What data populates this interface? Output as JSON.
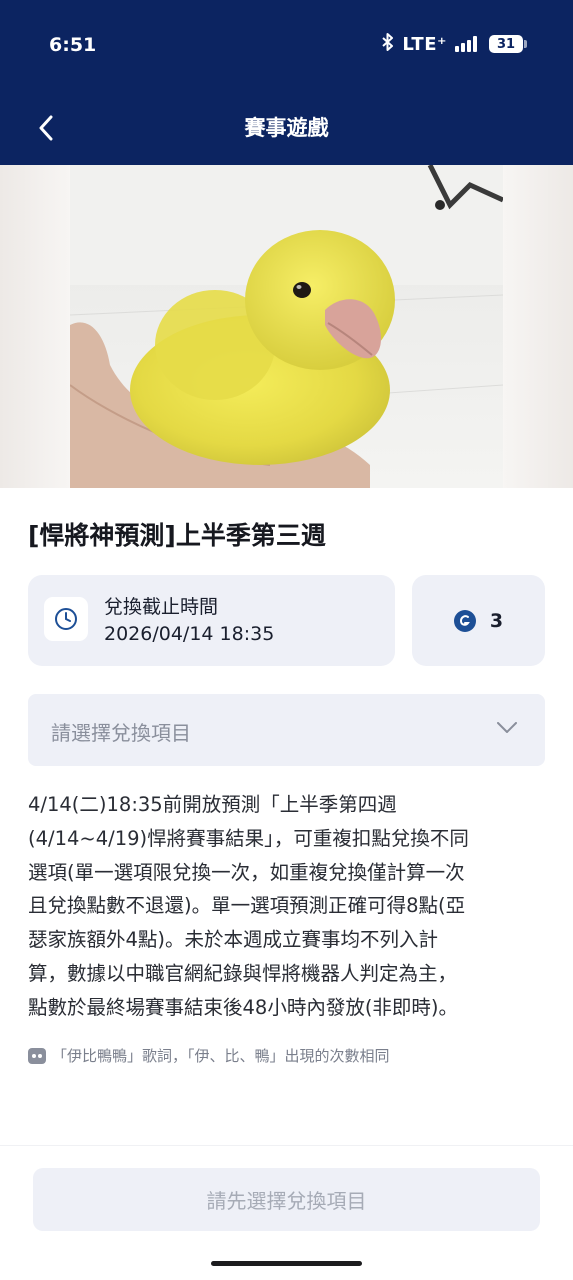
{
  "status_bar": {
    "time": "6:51",
    "network": "LTE⁺",
    "battery": "31"
  },
  "header": {
    "title": "賽事遊戲"
  },
  "event": {
    "title": "[悍將神預測]上半季第三週",
    "deadline_label": "兌換截止時間",
    "deadline_value": "2026/04/14 18:35",
    "cost": "3"
  },
  "select": {
    "placeholder": "請選擇兌換項目"
  },
  "description": {
    "lines": [
      "4/14(二)18:35前開放預測「上半季第四週",
      "(4/14~4/19)悍將賽事結果」，可重複扣點兌換不同",
      "選項(單一選項限兌換一次，如重複兌換僅計算一次",
      "且兌換點數不退還)。單一選項預測正確可得8點(亞",
      "瑟家族額外4點)。未於本週成立賽事均不列入計",
      "算，數據以中職官網紀錄與悍將機器人判定為主，",
      "點數於最終場賽事結束後48小時內發放(非即時)。"
    ]
  },
  "note": {
    "text": "「伊比鴨鴨」歌詞，「伊、比、鴨」出現的次數相同"
  },
  "footer": {
    "button_label": "請先選擇兌換項目"
  },
  "colors": {
    "header_bg": "#0c2461",
    "card_bg": "#eef0f7",
    "point_icon": "#1d4f96"
  }
}
